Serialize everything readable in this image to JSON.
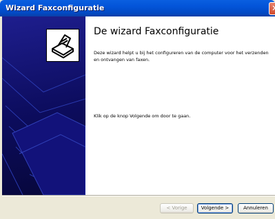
{
  "window": {
    "title": "Wizard Faxconfiguratie"
  },
  "content": {
    "heading": "De wizard Faxconfiguratie",
    "description": "Deze wizard helpt u bij het configureren van de computer voor het verzenden en ontvangen van faxen.",
    "instruction": "Klik op de knop Volgende om door te gaan."
  },
  "buttons": {
    "back": "< Vorige",
    "next": "Volgende >",
    "cancel": "Annuleren"
  }
}
